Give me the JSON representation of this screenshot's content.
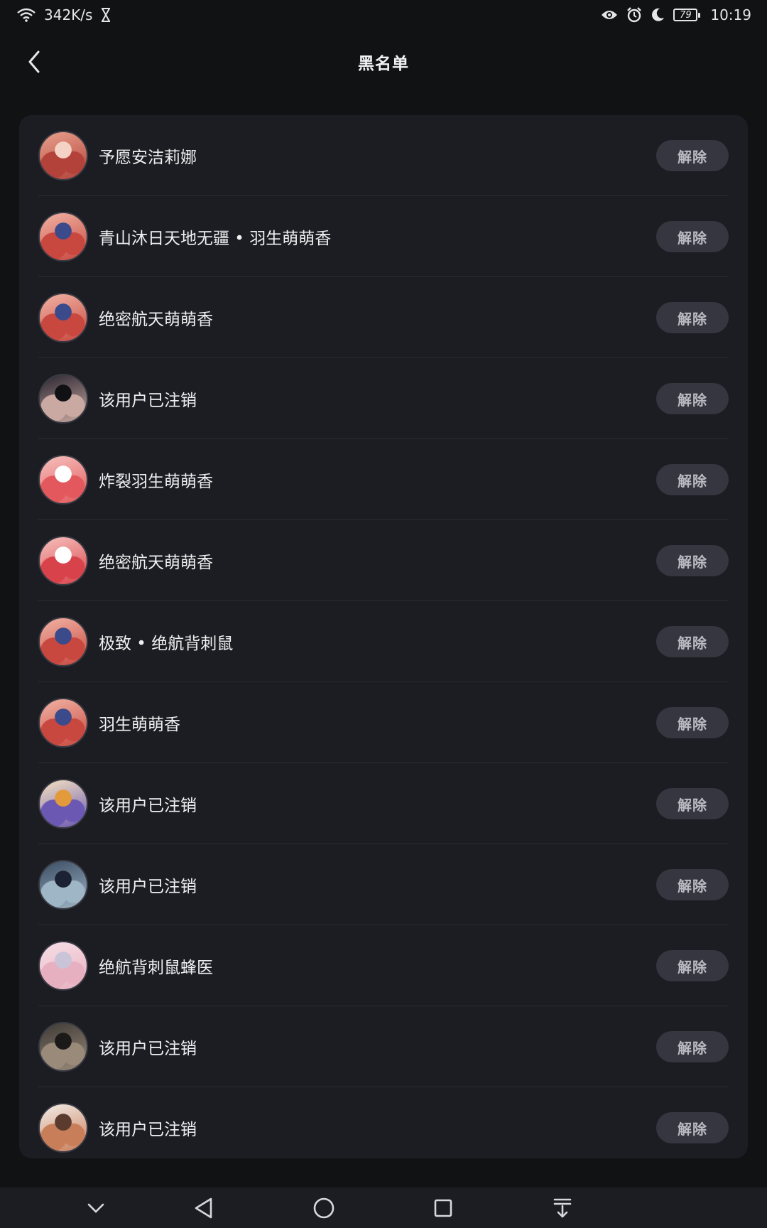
{
  "status_bar": {
    "net_speed": "342K/s",
    "battery_level": "79",
    "time": "10:19",
    "icons": [
      "wifi-icon",
      "hourglass-icon",
      "eye-icon",
      "alarm-icon",
      "moon-icon",
      "battery-icon"
    ]
  },
  "header": {
    "title": "黑名单",
    "back_icon": "chevron-left-icon"
  },
  "colors": {
    "background": "#111214",
    "card": "#1c1d22",
    "button_bg": "#35363f",
    "button_text": "#b9bac2"
  },
  "unblock_label": "解除",
  "users": [
    {
      "name": "予愿安洁莉娜",
      "avatar_colors": [
        "#e8a08c",
        "#b3423a",
        "#f4d3c6"
      ]
    },
    {
      "name": "青山沐日天地无疆 • 羽生萌萌香",
      "avatar_colors": [
        "#f0b3a4",
        "#c8473f",
        "#3b4a8a"
      ]
    },
    {
      "name": "绝密航天萌萌香",
      "avatar_colors": [
        "#f0b3a4",
        "#c8473f",
        "#3b4a8a"
      ]
    },
    {
      "name": "该用户已注销",
      "avatar_colors": [
        "#2a2530",
        "#c9a9a2",
        "#101015"
      ]
    },
    {
      "name": "炸裂羽生萌萌香",
      "avatar_colors": [
        "#f6c1bd",
        "#e2585c",
        "#ffffff"
      ]
    },
    {
      "name": "绝密航天萌萌香",
      "avatar_colors": [
        "#f6c1bd",
        "#d8434b",
        "#ffffff"
      ]
    },
    {
      "name": "极致 • 绝航背刺鼠",
      "avatar_colors": [
        "#f0b3a4",
        "#c8473f",
        "#3b4a8a"
      ]
    },
    {
      "name": "羽生萌萌香",
      "avatar_colors": [
        "#f0b3a4",
        "#c8473f",
        "#3b4a8a"
      ]
    },
    {
      "name": "该用户已注销",
      "avatar_colors": [
        "#f4e2c0",
        "#6b58b3",
        "#e39a3a"
      ]
    },
    {
      "name": "该用户已注销",
      "avatar_colors": [
        "#3b4c62",
        "#9fb6c6",
        "#1a2233"
      ]
    },
    {
      "name": "绝航背刺鼠蜂医",
      "avatar_colors": [
        "#f7dfe6",
        "#e7b0c0",
        "#c9c4d8"
      ]
    },
    {
      "name": "该用户已注销",
      "avatar_colors": [
        "#3e3a36",
        "#9a8a7a",
        "#1b1a19"
      ]
    },
    {
      "name": "该用户已注销",
      "avatar_colors": [
        "#f2ece6",
        "#c97e5a",
        "#5a3b2e"
      ]
    }
  ],
  "nav_bar": {
    "icons": [
      "collapse-icon",
      "back-triangle-icon",
      "home-circle-icon",
      "recents-square-icon",
      "notification-pull-icon"
    ]
  }
}
